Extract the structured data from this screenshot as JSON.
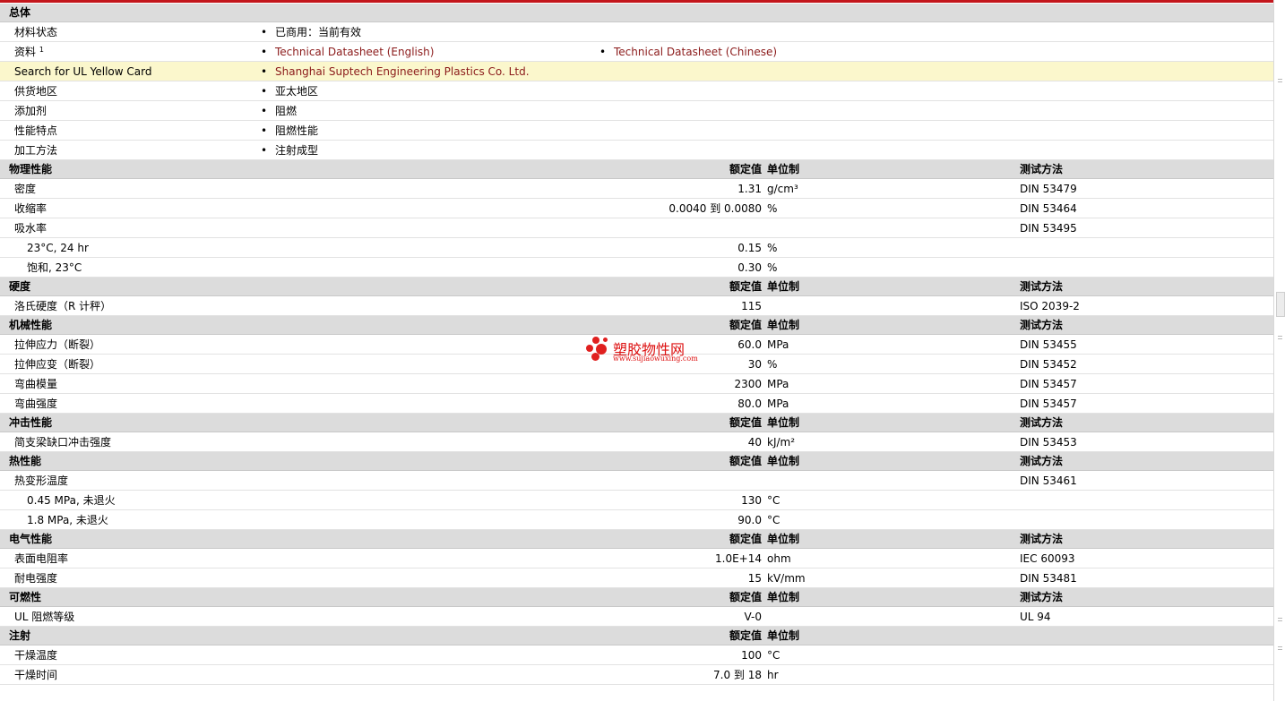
{
  "general": {
    "title": "总体",
    "rows": [
      {
        "name": "材料状态",
        "bullets": [
          "已商用：当前有效"
        ]
      },
      {
        "name": "资料",
        "sup": "1",
        "links": [
          "Technical Datasheet (English)",
          "Technical Datasheet (Chinese)"
        ]
      },
      {
        "name": "Search for UL Yellow Card",
        "links": [
          "Shanghai Suptech Engineering Plastics Co. Ltd."
        ],
        "highlight": true
      },
      {
        "name": "供货地区",
        "bullets": [
          "亚太地区"
        ]
      },
      {
        "name": "添加剂",
        "bullets": [
          "阻燃"
        ]
      },
      {
        "name": "性能特点",
        "bullets": [
          "阻燃性能"
        ]
      },
      {
        "name": "加工方法",
        "bullets": [
          "注射成型"
        ]
      }
    ]
  },
  "columns": {
    "value": "额定值",
    "unit": "单位制",
    "method": "测试方法"
  },
  "sections": [
    {
      "title": "物理性能",
      "show_method": true,
      "rows": [
        {
          "name": "密度",
          "value": "1.31",
          "unit": "g/cm³",
          "method": "DIN 53479"
        },
        {
          "name": "收缩率",
          "value": "0.0040 到  0.0080",
          "unit": "%",
          "method": "DIN 53464"
        },
        {
          "name": "吸水率",
          "value": "",
          "unit": "",
          "method": "DIN 53495"
        },
        {
          "name": "23°C, 24 hr",
          "sub": true,
          "value": "0.15",
          "unit": "%",
          "method": ""
        },
        {
          "name": "饱和, 23°C",
          "sub": true,
          "value": "0.30",
          "unit": "%",
          "method": ""
        }
      ]
    },
    {
      "title": "硬度",
      "show_method": true,
      "rows": [
        {
          "name": "洛氏硬度（R 计秤）",
          "value": "115",
          "unit": "",
          "method": "ISO 2039-2"
        }
      ]
    },
    {
      "title": "机械性能",
      "show_method": true,
      "rows": [
        {
          "name": "拉伸应力（断裂）",
          "value": "60.0",
          "unit": "MPa",
          "method": "DIN 53455"
        },
        {
          "name": "拉伸应变（断裂）",
          "value": "30",
          "unit": "%",
          "method": "DIN 53452"
        },
        {
          "name": "弯曲模量",
          "value": "2300",
          "unit": "MPa",
          "method": "DIN 53457"
        },
        {
          "name": "弯曲强度",
          "value": "80.0",
          "unit": "MPa",
          "method": "DIN 53457"
        }
      ]
    },
    {
      "title": "冲击性能",
      "show_method": true,
      "rows": [
        {
          "name": "简支梁缺口冲击强度",
          "value": "40",
          "unit": "kJ/m²",
          "method": "DIN 53453"
        }
      ]
    },
    {
      "title": "热性能",
      "show_method": true,
      "rows": [
        {
          "name": "热变形温度",
          "value": "",
          "unit": "",
          "method": "DIN 53461"
        },
        {
          "name": "0.45 MPa, 未退火",
          "sub": true,
          "value": "130",
          "unit": "°C",
          "method": ""
        },
        {
          "name": "1.8 MPa, 未退火",
          "sub": true,
          "value": "90.0",
          "unit": "°C",
          "method": ""
        }
      ]
    },
    {
      "title": "电气性能",
      "show_method": true,
      "rows": [
        {
          "name": "表面电阻率",
          "value": "1.0E+14",
          "unit": "ohm",
          "method": "IEC 60093"
        },
        {
          "name": "耐电强度",
          "value": "15",
          "unit": "kV/mm",
          "method": "DIN 53481"
        }
      ]
    },
    {
      "title": "可燃性",
      "show_method": true,
      "rows": [
        {
          "name": "UL 阻燃等级",
          "value": "V-0",
          "unit": "",
          "method": "UL 94"
        }
      ]
    },
    {
      "title": "注射",
      "show_method": false,
      "rows": [
        {
          "name": "干燥温度",
          "value": "100",
          "unit": "°C",
          "method": ""
        },
        {
          "name": "干燥时间",
          "value": "7.0 到  18",
          "unit": "hr",
          "method": ""
        }
      ]
    }
  ],
  "watermark": {
    "text": "塑胶物性网",
    "url": "www.sujiaowuxing.com"
  },
  "colors": {
    "top_bar": "#c3161c",
    "header_bg": "#dcdcdc",
    "highlight_bg": "#fbf7cc",
    "link": "#8b1a1a"
  }
}
